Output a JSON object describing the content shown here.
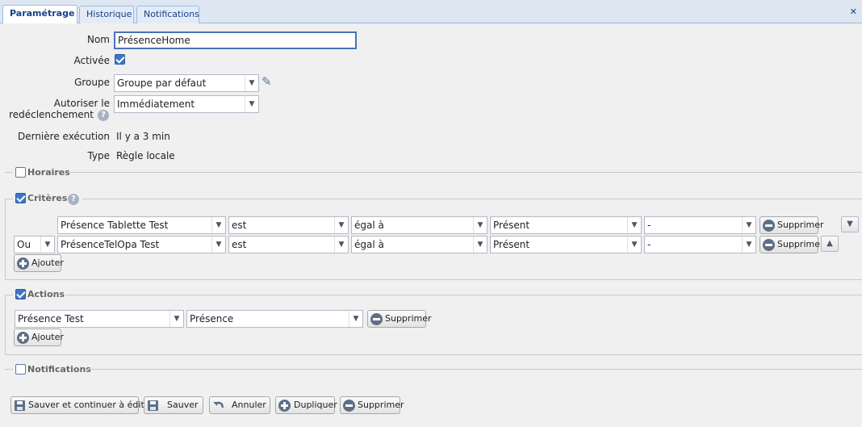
{
  "tabs": [
    {
      "label": "Paramétrage",
      "active": true
    },
    {
      "label": "Historique",
      "active": false
    },
    {
      "label": "Notifications",
      "active": false
    }
  ],
  "close_glyph": "✕",
  "form": {
    "nom_label": "Nom",
    "nom_value": "PrésenceHome",
    "activee_label": "Activée",
    "activee_checked": true,
    "groupe_label": "Groupe",
    "groupe_value": "Groupe par défaut",
    "autoriser_label_1": "Autoriser le",
    "autoriser_label_2": "redéclenchement",
    "autoriser_value": "Immédiatement",
    "derniere_label": "Dernière exécution",
    "derniere_value": "Il y a 3 min",
    "type_label": "Type",
    "type_value": "Règle locale"
  },
  "sections": {
    "horaires": {
      "label": "Horaires",
      "checked": false
    },
    "criteres": {
      "label": "Critères",
      "checked": true
    },
    "actions": {
      "label": "Actions",
      "checked": true
    },
    "notifications": {
      "label": "Notifications",
      "checked": false
    }
  },
  "criteres_rows": [
    {
      "connector": "",
      "device": "Présence Tablette Test",
      "op": "est",
      "cmp": "égal à",
      "value": "Présent",
      "extra": "-",
      "delete": "Supprimer",
      "move": "▼"
    },
    {
      "connector": "Ou",
      "device": "PrésenceTelOpa Test",
      "op": "est",
      "cmp": "égal à",
      "value": "Présent",
      "extra": "-",
      "delete": "Supprimer",
      "move": "▲"
    }
  ],
  "criteres_add": "Ajouter",
  "actions_rows": [
    {
      "device": "Présence Test",
      "value": "Présence",
      "delete": "Supprimer"
    }
  ],
  "actions_add": "Ajouter",
  "footer": {
    "save_continue": "Sauver et continuer à éditer",
    "save": "Sauver",
    "cancel": "Annuler",
    "duplicate": "Dupliquer",
    "delete": "Supprimer"
  },
  "colors": {
    "accent": "#15428b",
    "checkbox": "#3c76c7",
    "icon": "#5d6f85"
  }
}
